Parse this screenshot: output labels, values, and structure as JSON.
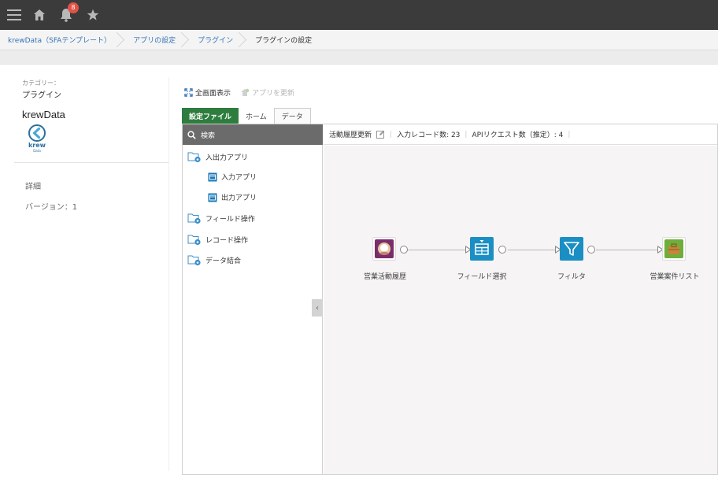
{
  "navbar": {
    "menu_icon": "hamburger-menu-icon",
    "home_icon": "home-icon",
    "bell_icon": "bell-icon",
    "notification_count": "8",
    "star_icon": "star-icon"
  },
  "breadcrumb": [
    {
      "label": "krewData（SFAテンプレート）"
    },
    {
      "label": "アプリの設定"
    },
    {
      "label": "プラグイン"
    },
    {
      "label": "プラグインの設定"
    }
  ],
  "sidebar": {
    "category_label": "カテゴリー：",
    "category_value": "プラグイン",
    "app_name": "krewData",
    "logo_text": "krew",
    "logo_subtext": "Data",
    "detail_label": "詳細",
    "version_label": "バージョン：1"
  },
  "toolbar": {
    "fullscreen_label": "全画面表示",
    "update_app_label": "アプリを更新"
  },
  "tabs": [
    {
      "label": "設定ファイル",
      "active": true
    },
    {
      "label": "ホーム",
      "active": false
    },
    {
      "label": "データ",
      "active": false
    }
  ],
  "tree": {
    "search_label": "検索",
    "items": [
      {
        "label": "入出力アプリ",
        "type": "folder",
        "level": 0
      },
      {
        "label": "入力アプリ",
        "type": "app",
        "level": 1
      },
      {
        "label": "出力アプリ",
        "type": "app",
        "level": 1
      },
      {
        "label": "フィールド操作",
        "type": "folder",
        "level": 0
      },
      {
        "label": "レコード操作",
        "type": "folder",
        "level": 0
      },
      {
        "label": "データ結合",
        "type": "folder",
        "level": 0
      }
    ],
    "collapse_symbol": "‹"
  },
  "canvas_header": {
    "flow_name": "活動履歴更新",
    "input_records": "入力レコード数: 23",
    "api_requests": "APIリクエスト数（推定）: 4"
  },
  "flow": {
    "nodes": [
      {
        "label": "営業活動履歴",
        "icon": "person-app-icon",
        "color": "#7b2d6b"
      },
      {
        "label": "フィールド選択",
        "icon": "table-select-icon",
        "color": "#1b8fc4"
      },
      {
        "label": "フィルタ",
        "icon": "filter-icon",
        "color": "#1b8fc4"
      },
      {
        "label": "営業案件リスト",
        "icon": "briefcase-app-icon",
        "color": "#6fae3c"
      }
    ]
  },
  "colors": {
    "navbar_bg": "#3b3b3b",
    "link": "#3674b5",
    "tab_active": "#2e7d3e",
    "node_blue": "#1b8fc4",
    "badge": "#e35247"
  }
}
